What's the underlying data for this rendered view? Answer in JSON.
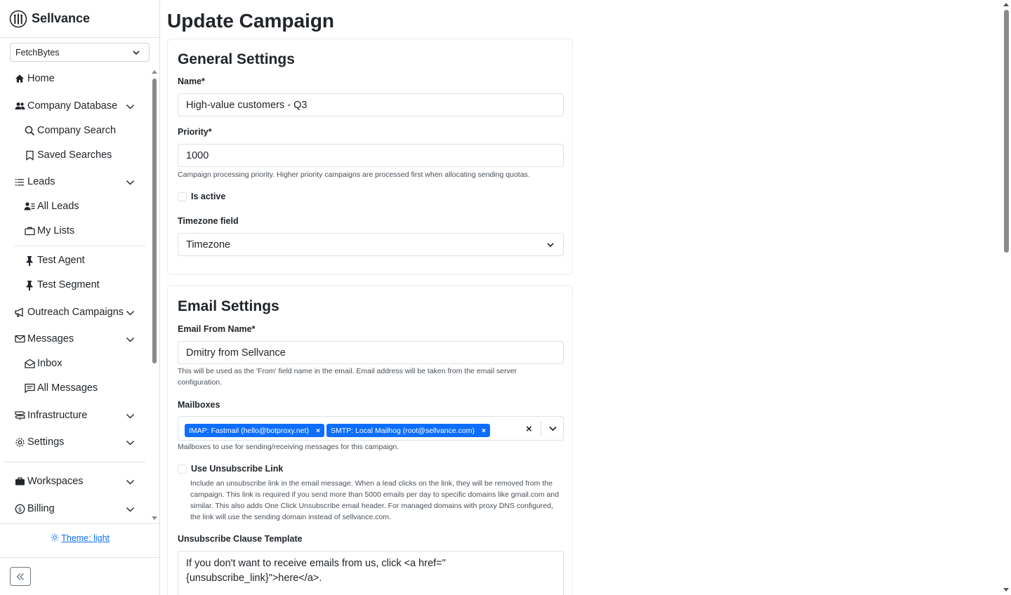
{
  "app": {
    "name": "Sellvance"
  },
  "workspace_select": {
    "value": "FetchBytes"
  },
  "nav": {
    "home": "Home",
    "company_database": "Company Database",
    "company_search": "Company Search",
    "saved_searches": "Saved Searches",
    "leads": "Leads",
    "all_leads": "All Leads",
    "my_lists": "My Lists",
    "test_agent": "Test Agent",
    "test_segment": "Test Segment",
    "outreach_campaigns": "Outreach Campaigns",
    "messages": "Messages",
    "inbox": "Inbox",
    "all_messages": "All Messages",
    "infrastructure": "Infrastructure",
    "settings": "Settings",
    "workspaces": "Workspaces",
    "billing": "Billing"
  },
  "theme_toggle": "Theme: light",
  "page": {
    "title": "Update Campaign"
  },
  "general": {
    "title": "General Settings",
    "name_label": "Name*",
    "name_value": "High-value customers - Q3",
    "priority_label": "Priority*",
    "priority_value": "1000",
    "priority_help": "Campaign processing priority. Higher priority campaigns are processed first when allocating sending quotas.",
    "is_active_label": "Is active",
    "timezone_label": "Timezone field",
    "timezone_value": "Timezone"
  },
  "email": {
    "title": "Email Settings",
    "from_name_label": "Email From Name*",
    "from_name_value": "Dmitry from Sellvance",
    "from_name_help": "This will be used as the 'From' field name in the email. Email address will be taken from the email server configuration.",
    "mailboxes_label": "Mailboxes",
    "mailboxes": [
      "IMAP: Fastmail (hello@botproxy.net)",
      "SMTP: Local Mailhog (root@sellvance.com)"
    ],
    "mailboxes_help": "Mailboxes to use for sending/receiving messages for this campaign.",
    "unsubscribe_label": "Use Unsubscribe Link",
    "unsubscribe_help": "Include an unsubscribe link in the email message. When a lead clicks on the link, they will be removed from the campaign. This link is required if you send more than 5000 emails per day to specific domains like gmail.com and similar. This also adds One Click Unsubscribe email header. For managed domains with proxy DNS configured, the link will use the sending domain instead of sellvance.com.",
    "clause_label": "Unsubscribe Clause Template",
    "clause_value": "If you don't want to receive emails from us, click <a href=\"{unsubscribe_link}\">here</a>."
  },
  "colors": {
    "accent": "#0d6efd",
    "border": "#dee2e6",
    "text": "#212529"
  }
}
